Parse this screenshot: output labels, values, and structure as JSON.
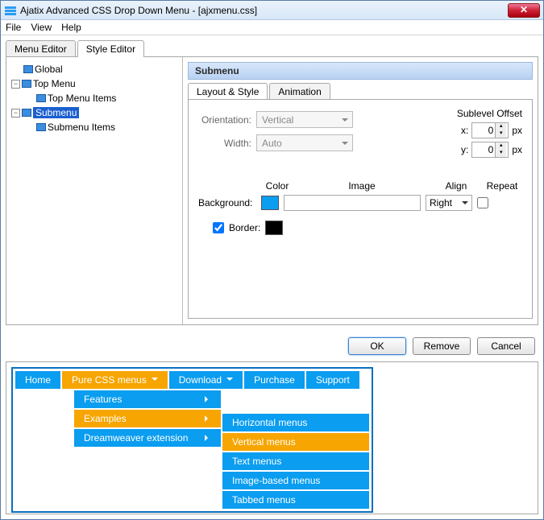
{
  "window": {
    "title": "Ajatix Advanced CSS Drop Down Menu - [ajxmenu.css]"
  },
  "menubar": [
    "File",
    "View",
    "Help"
  ],
  "tabs": {
    "menuEditor": "Menu Editor",
    "styleEditor": "Style Editor"
  },
  "tree": {
    "global": "Global",
    "topMenu": "Top Menu",
    "topMenuItems": "Top Menu Items",
    "submenu": "Submenu",
    "submenuItems": "Submenu Items"
  },
  "section": {
    "title": "Submenu"
  },
  "subtabs": {
    "layout": "Layout & Style",
    "animation": "Animation"
  },
  "form": {
    "orientationLabel": "Orientation:",
    "orientationValue": "Vertical",
    "widthLabel": "Width:",
    "widthValue": "Auto",
    "offsetTitle": "Sublevel Offset",
    "xLabel": "x:",
    "xValue": "0",
    "yLabel": "y:",
    "yValue": "0",
    "px": "px",
    "hdrColor": "Color",
    "hdrImage": "Image",
    "hdrAlign": "Align",
    "hdrRepeat": "Repeat",
    "bgLabel": "Background:",
    "bgColor": "#0a9df0",
    "alignValue": "Right",
    "borderLabel": "Border:",
    "borderColor": "#000000"
  },
  "buttons": {
    "ok": "OK",
    "remove": "Remove",
    "cancel": "Cancel"
  },
  "preview": {
    "top": [
      "Home",
      "Pure CSS menus",
      "Download",
      "Purchase",
      "Support"
    ],
    "col1": [
      "Features",
      "Examples",
      "Dreamweaver extension"
    ],
    "col2": [
      "Horizontal menus",
      "Vertical menus",
      "Text menus",
      "Image-based menus",
      "Tabbed menus"
    ]
  }
}
